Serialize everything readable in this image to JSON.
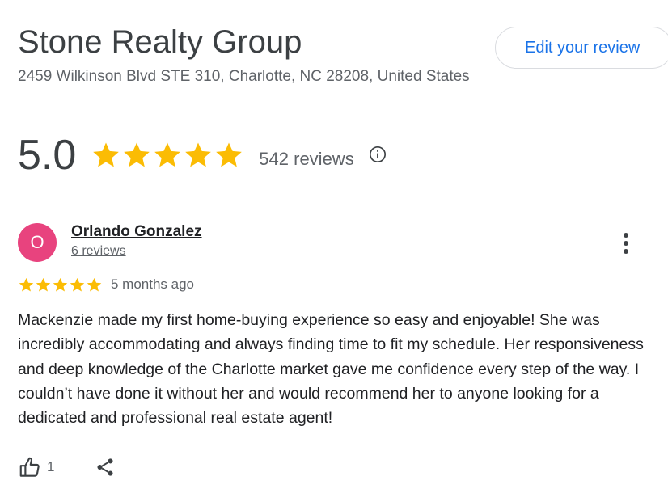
{
  "business": {
    "name": "Stone Realty Group",
    "address": "2459 Wilkinson Blvd STE 310, Charlotte, NC 28208, United States",
    "edit_review_label": "Edit your review"
  },
  "summary": {
    "rating": "5.0",
    "stars": 5,
    "reviews_label": "542 reviews",
    "info_icon": "info-icon"
  },
  "review": {
    "avatar_initial": "O",
    "avatar_color": "#e8437e",
    "reviewer_name": "Orlando Gonzalez",
    "reviewer_reviews": "6 reviews",
    "stars": 5,
    "time_ago": "5 months ago",
    "text": "Mackenzie made my first home-buying experience so easy and enjoyable! She was incredibly accommodating and always finding time to fit my schedule. Her responsiveness and deep knowledge of the Charlotte market gave me confidence every step of the way. I couldn’t have done it without her and would recommend her to anyone looking for a dedicated and professional real estate agent!",
    "likes": "1",
    "more_icon": "more-vertical-icon",
    "like_icon": "thumbs-up-icon",
    "share_icon": "share-icon"
  },
  "colors": {
    "star": "#fbbc04",
    "accent": "#1a73e8",
    "text_secondary": "#5f6368"
  }
}
